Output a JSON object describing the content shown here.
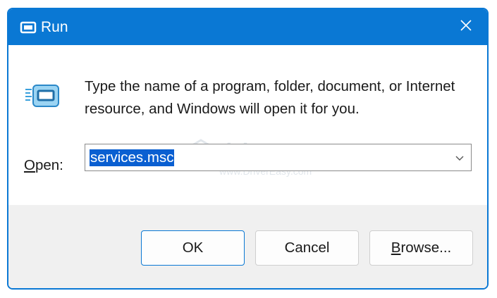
{
  "window": {
    "title": "Run",
    "accent_color": "#0a78d4",
    "title_icon": "run-app-icon",
    "close_icon": "close-icon"
  },
  "content": {
    "icon": "run-app-icon",
    "description": "Type the name of a program, folder, document, or Internet resource, and Windows will open it for you.",
    "open_label_accel": "O",
    "open_label_rest": "pen:",
    "open_value": "services.msc",
    "dropdown_icon": "chevron-down-icon"
  },
  "watermark": {
    "brand": "driver easy",
    "url": "www.DriverEasy.com"
  },
  "buttons": {
    "ok": "OK",
    "cancel": "Cancel",
    "browse_accel": "B",
    "browse_rest": "rowse..."
  }
}
